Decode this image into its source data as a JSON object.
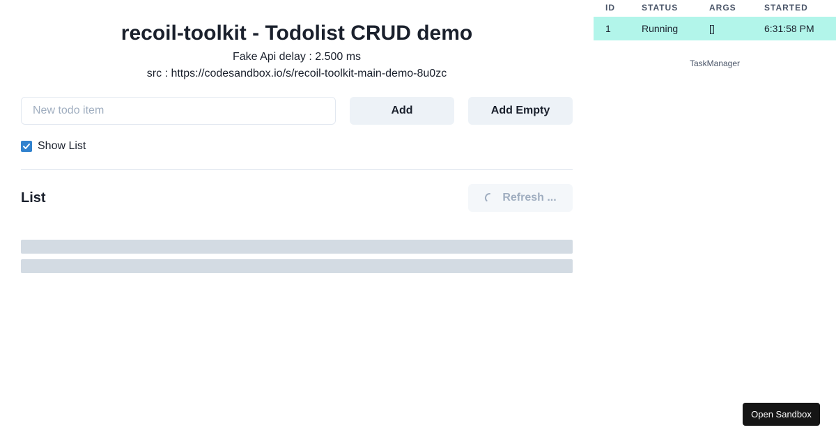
{
  "header": {
    "title": "recoil-toolkit - Todolist CRUD demo",
    "delay_text": "Fake Api delay : 2.500 ms",
    "src_text": "src : https://codesandbox.io/s/recoil-toolkit-main-demo-8u0zc"
  },
  "todo_form": {
    "input_placeholder": "New todo item",
    "input_value": "",
    "add_label": "Add",
    "add_empty_label": "Add Empty"
  },
  "show_list": {
    "label": "Show List",
    "checked": true
  },
  "list": {
    "heading": "List",
    "refresh_label": "Refresh ...",
    "loading": true
  },
  "task_manager": {
    "columns": [
      "ID",
      "STATUS",
      "ARGS",
      "STARTED"
    ],
    "rows": [
      {
        "id": "1",
        "status": "Running",
        "args": "[]",
        "started": "6:31:58 PM"
      }
    ],
    "caption": "TaskManager"
  },
  "open_sandbox": {
    "label": "Open Sandbox"
  },
  "colors": {
    "checkbox": "#3182ce",
    "running_row": "#b2f5ea",
    "button_bg": "#edf2f7",
    "skeleton": "#d3dbe3",
    "sandbox_bg": "#151515"
  }
}
